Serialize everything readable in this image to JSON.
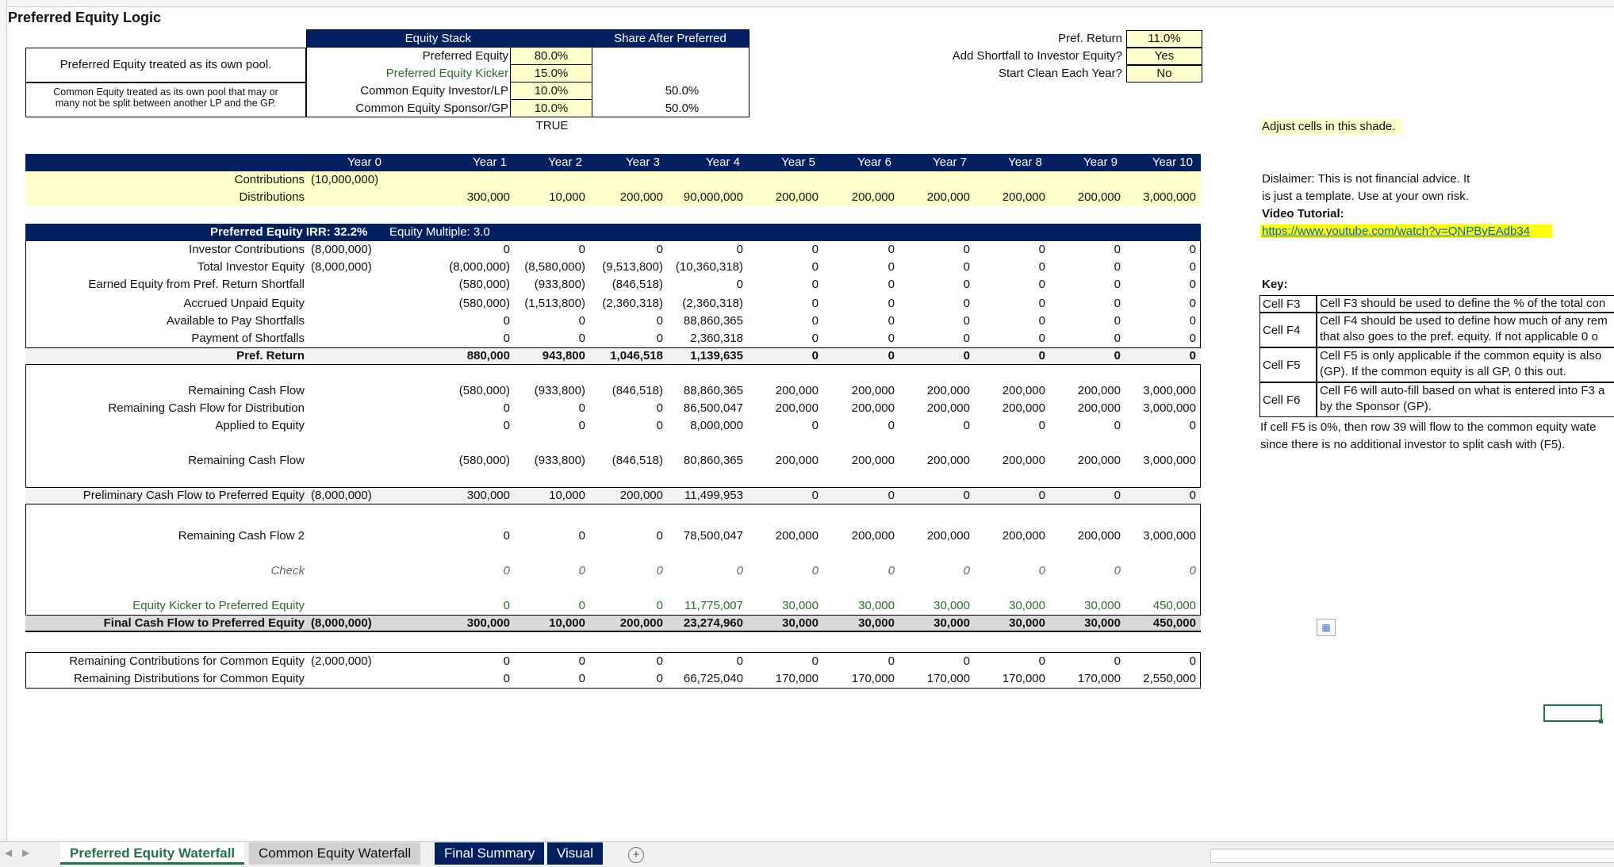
{
  "title": "Preferred Equity Logic",
  "notes": {
    "pref_pool": "Preferred Equity treated as its own pool.",
    "common_pool_1": "Common Equity treated as its own pool that may or",
    "common_pool_2": "many not be split between another LP and the GP."
  },
  "equity_stack": {
    "header": "Equity Stack",
    "share_header": "Share After Preferred",
    "rows": [
      {
        "label": "Preferred Equity",
        "value": "80.0%",
        "share": ""
      },
      {
        "label": "Preferred Equity Kicker",
        "value": "15.0%",
        "share": ""
      },
      {
        "label": "Common Equity Investor/LP",
        "value": "10.0%",
        "share": "50.0%"
      },
      {
        "label": "Common Equity Sponsor/GP",
        "value": "10.0%",
        "share": "50.0%"
      }
    ],
    "true_text": "TRUE"
  },
  "settings": [
    {
      "label": "Pref. Return",
      "value": "11.0%"
    },
    {
      "label": "Add Shortfall to Investor Equity?",
      "value": "Yes"
    },
    {
      "label": "Start Clean Each Year?",
      "value": "No"
    }
  ],
  "adjust_note": "Adjust cells in this shade.",
  "years": [
    "Year 0",
    "Year 1",
    "Year 2",
    "Year 3",
    "Year 4",
    "Year 5",
    "Year 6",
    "Year 7",
    "Year 8",
    "Year 9",
    "Year 10"
  ],
  "contributions": {
    "label": "Contributions",
    "values": [
      "(10,000,000)",
      "",
      "",
      "",
      "",
      "",
      "",
      "",
      "",
      "",
      ""
    ]
  },
  "distributions": {
    "label": "Distributions",
    "values": [
      "",
      "300,000",
      "10,000",
      "200,000",
      "90,000,000",
      "200,000",
      "200,000",
      "200,000",
      "200,000",
      "200,000",
      "3,000,000"
    ]
  },
  "pref_header": {
    "irr": "Preferred Equity  IRR: 32.2%",
    "multiple": "Equity Multiple: 3.0"
  },
  "rows_a": [
    {
      "label": "Investor Contributions",
      "values": [
        "(8,000,000)",
        "0",
        "0",
        "0",
        "0",
        "0",
        "0",
        "0",
        "0",
        "0",
        "0"
      ]
    },
    {
      "label": "Total Investor Equity",
      "values": [
        "(8,000,000)",
        "(8,000,000)",
        "(8,580,000)",
        "(9,513,800)",
        "(10,360,318)",
        "0",
        "0",
        "0",
        "0",
        "0",
        "0"
      ]
    },
    {
      "label": "Earned Equity from Pref. Return Shortfall",
      "values": [
        "",
        "(580,000)",
        "(933,800)",
        "(846,518)",
        "0",
        "0",
        "0",
        "0",
        "0",
        "0",
        "0"
      ]
    },
    {
      "label": "Accrued Unpaid Equity",
      "values": [
        "",
        "(580,000)",
        "(1,513,800)",
        "(2,360,318)",
        "(2,360,318)",
        "0",
        "0",
        "0",
        "0",
        "0",
        "0"
      ]
    },
    {
      "label": "Available to Pay Shortfalls",
      "values": [
        "",
        "0",
        "0",
        "0",
        "88,860,365",
        "0",
        "0",
        "0",
        "0",
        "0",
        "0"
      ]
    },
    {
      "label": "Payment of Shortfalls",
      "values": [
        "",
        "0",
        "0",
        "0",
        "2,360,318",
        "0",
        "0",
        "0",
        "0",
        "0",
        "0"
      ]
    }
  ],
  "pref_return": {
    "label": "Pref. Return",
    "values": [
      "",
      "880,000",
      "943,800",
      "1,046,518",
      "1,139,635",
      "0",
      "0",
      "0",
      "0",
      "0",
      "0"
    ]
  },
  "rows_b": [
    {
      "label": "Remaining Cash Flow",
      "values": [
        "",
        "(580,000)",
        "(933,800)",
        "(846,518)",
        "88,860,365",
        "200,000",
        "200,000",
        "200,000",
        "200,000",
        "200,000",
        "3,000,000"
      ]
    },
    {
      "label": "Remaining Cash Flow for Distribution",
      "values": [
        "",
        "0",
        "0",
        "0",
        "86,500,047",
        "200,000",
        "200,000",
        "200,000",
        "200,000",
        "200,000",
        "3,000,000"
      ]
    },
    {
      "label": "Applied to Equity",
      "values": [
        "",
        "0",
        "0",
        "0",
        "8,000,000",
        "0",
        "0",
        "0",
        "0",
        "0",
        "0"
      ]
    }
  ],
  "remaining_cf": {
    "label": "Remaining Cash Flow",
    "values": [
      "",
      "(580,000)",
      "(933,800)",
      "(846,518)",
      "80,860,365",
      "200,000",
      "200,000",
      "200,000",
      "200,000",
      "200,000",
      "3,000,000"
    ]
  },
  "prelim": {
    "label": "Preliminary Cash Flow to Preferred Equity",
    "values": [
      "(8,000,000)",
      "300,000",
      "10,000",
      "200,000",
      "11,499,953",
      "0",
      "0",
      "0",
      "0",
      "0",
      "0"
    ]
  },
  "remaining_cf2": {
    "label": "Remaining Cash Flow 2",
    "values": [
      "",
      "0",
      "0",
      "0",
      "78,500,047",
      "200,000",
      "200,000",
      "200,000",
      "200,000",
      "200,000",
      "3,000,000"
    ]
  },
  "check": {
    "label": "Check",
    "values": [
      "",
      "0",
      "0",
      "0",
      "0",
      "0",
      "0",
      "0",
      "0",
      "0",
      "0"
    ]
  },
  "kicker": {
    "label": "Equity Kicker to Preferred Equity",
    "values": [
      "",
      "0",
      "0",
      "0",
      "11,775,007",
      "30,000",
      "30,000",
      "30,000",
      "30,000",
      "30,000",
      "450,000"
    ]
  },
  "final_cf": {
    "label": "Final Cash Flow to Preferred Equity",
    "values": [
      "(8,000,000)",
      "300,000",
      "10,000",
      "200,000",
      "23,274,960",
      "30,000",
      "30,000",
      "30,000",
      "30,000",
      "30,000",
      "450,000"
    ]
  },
  "common_contrib": {
    "label": "Remaining Contributions for Common Equity",
    "values": [
      "(2,000,000)",
      "0",
      "0",
      "0",
      "0",
      "0",
      "0",
      "0",
      "0",
      "0",
      "0"
    ]
  },
  "common_dist": {
    "label": "Remaining Distributions for Common Equity",
    "values": [
      "",
      "0",
      "0",
      "0",
      "66,725,040",
      "170,000",
      "170,000",
      "170,000",
      "170,000",
      "170,000",
      "2,550,000"
    ]
  },
  "disclaimer": {
    "line1": "Dislaimer: This is not financial advice. It",
    "line2": "is just a template. Use at your own risk.",
    "video_label": "Video Tutorial:",
    "link": "https://www.youtube.com/watch?v=QNPByEAdb34"
  },
  "key": {
    "title": "Key:",
    "rows": [
      {
        "cell": "Cell F3",
        "text": [
          "Cell F3 should be used to define the % of the total con"
        ]
      },
      {
        "cell": "Cell F4",
        "text": [
          "Cell F4 should be used to define how much of any rem",
          "that also goes to the pref. equity. If not applicable 0 o"
        ]
      },
      {
        "cell": "Cell F5",
        "text": [
          "Cell F5 is only applicable if the common equity is also",
          "(GP). If the common equity is all GP, 0 this out."
        ]
      },
      {
        "cell": "Cell F6",
        "text": [
          "Cell F6 will auto-fill based on what is entered into F3 a",
          "by the Sponsor (GP)."
        ]
      }
    ],
    "footer1": "If cell F5 is 0%, then row 39 will flow to the common equity wate",
    "footer2": "since there is no additional investor to split cash with (F5)."
  },
  "tabs": [
    "Preferred Equity Waterfall",
    "Common Equity Waterfall",
    "Final Summary",
    "Visual"
  ],
  "colors": {
    "header": "#002060",
    "input": "#ffffcc",
    "link": "#0563c1"
  }
}
